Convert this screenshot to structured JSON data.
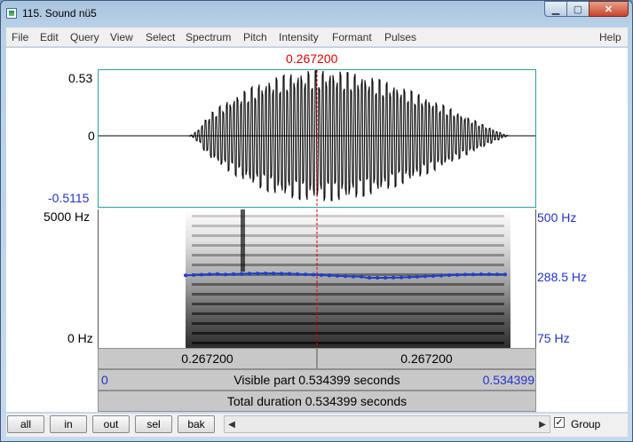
{
  "window": {
    "title": "115. Sound nü5"
  },
  "menu": [
    "File",
    "Edit",
    "Query",
    "View",
    "Select",
    "Spectrum",
    "Pitch",
    "Intensity",
    "Formant",
    "Pulses"
  ],
  "help": "Help",
  "cursor_time": "0.267200",
  "waveform": {
    "ymax": "0.53",
    "ymid": "0",
    "ymin": "-0.5115"
  },
  "spectrogram": {
    "freq_top": "5000 Hz",
    "freq_bottom": "0 Hz",
    "pitch_top": "500 Hz",
    "pitch_mid": "288.5 Hz",
    "pitch_bottom": "75 Hz"
  },
  "time_bars": {
    "left_duration": "0.267200",
    "right_duration": "0.267200",
    "visible_start": "0",
    "visible_label": "Visible part 0.534399 seconds",
    "visible_end": "0.534399",
    "total_label": "Total duration 0.534399 seconds"
  },
  "buttons": {
    "all": "all",
    "in": "in",
    "out": "out",
    "sel": "sel",
    "bak": "bak"
  },
  "group": {
    "label": "Group",
    "checked": true
  },
  "colors": {
    "cursor": "#e00000",
    "pitch": "#1f3fcc",
    "axis_blue": "#2233cc"
  }
}
